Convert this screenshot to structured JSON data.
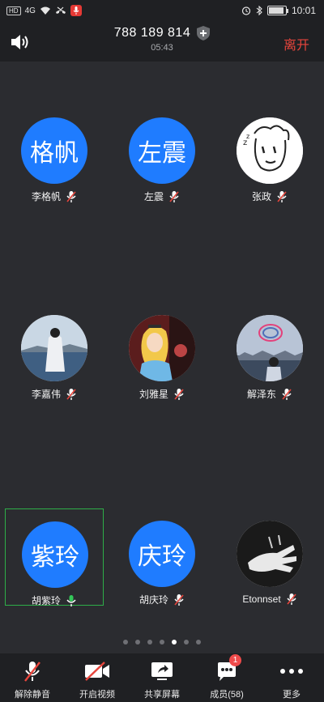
{
  "status_bar": {
    "network_chip": "HD",
    "network_type": "4G",
    "time": "10:01",
    "battery_percent": 90
  },
  "header": {
    "meeting_id": "788 189 814",
    "duration": "05:43",
    "leave_label": "离开",
    "shield_icon": "shield-plus-icon",
    "speaker_icon": "speaker-icon"
  },
  "participants": [
    {
      "name": "李格帆",
      "avatar_text": "格帆",
      "avatar_type": "text",
      "mic": "muted"
    },
    {
      "name": "左震",
      "avatar_text": "左震",
      "avatar_type": "text",
      "mic": "muted"
    },
    {
      "name": "张政",
      "avatar_text": "",
      "avatar_type": "sketch-face",
      "mic": "muted"
    },
    {
      "name": "李嘉伟",
      "avatar_text": "",
      "avatar_type": "photo-seaside",
      "mic": "muted"
    },
    {
      "name": "刘雅星",
      "avatar_text": "",
      "avatar_type": "photo-cartoon",
      "mic": "muted"
    },
    {
      "name": "解泽东",
      "avatar_text": "",
      "avatar_type": "photo-halo",
      "mic": "muted"
    },
    {
      "name": "胡紫玲",
      "avatar_text": "紫玲",
      "avatar_type": "text",
      "mic": "active",
      "highlighted": true
    },
    {
      "name": "胡庆玲",
      "avatar_text": "庆玲",
      "avatar_type": "text",
      "mic": "muted"
    },
    {
      "name": "Etonnset",
      "avatar_text": "",
      "avatar_type": "photo-hand",
      "mic": "muted"
    }
  ],
  "pagination": {
    "total": 7,
    "current": 5
  },
  "toolbar": {
    "unmute_label": "解除静音",
    "video_label": "开启视频",
    "share_label": "共享屏幕",
    "members_label": "成员(58)",
    "members_badge": "1",
    "more_label": "更多"
  },
  "colors": {
    "background": "#2b2c30",
    "bar": "#1f2023",
    "avatar_blue": "#1f7cff",
    "leave_red": "#e8453c",
    "active_green": "#2eae48"
  }
}
